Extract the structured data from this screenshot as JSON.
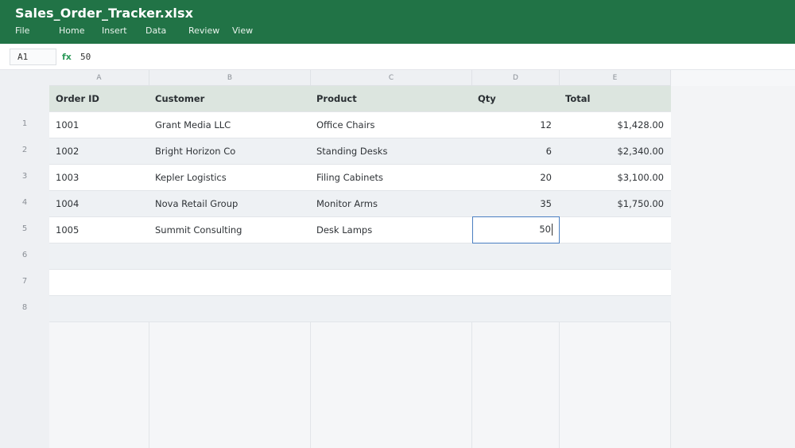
{
  "window": {
    "title": "Sales_Order_Tracker.xlsx",
    "menu": [
      "File",
      "Home",
      "Insert",
      "Data",
      "Review",
      "View"
    ]
  },
  "formula_bar": {
    "cell_ref": "A1",
    "fx_label": "fx",
    "value": "50"
  },
  "columns": [
    "A",
    "B",
    "C",
    "D",
    "E"
  ],
  "row_numbers": [
    "1",
    "2",
    "3",
    "4",
    "5",
    "6",
    "7",
    "8"
  ],
  "table": {
    "headers": [
      "Order ID",
      "Customer",
      "Product",
      "Qty",
      "Total"
    ],
    "rows": [
      [
        "1001",
        "Grant Media LLC",
        "Office Chairs",
        "12",
        "$1,428.00"
      ],
      [
        "1002",
        "Bright Horizon Co",
        "Standing Desks",
        "6",
        "$2,340.00"
      ],
      [
        "1003",
        "Kepler Logistics",
        "Filing Cabinets",
        "20",
        "$3,100.00"
      ],
      [
        "1004",
        "Nova Retail Group",
        "Monitor Arms",
        "35",
        "$1,750.00"
      ],
      [
        "1005",
        "Summit Consulting",
        "Desk Lamps",
        "50",
        ""
      ]
    ]
  },
  "active_cell": {
    "value": "50"
  },
  "colors": {
    "titlebar": "#217346",
    "header_row": "#dce5df",
    "selection": "#4a7fc1"
  }
}
